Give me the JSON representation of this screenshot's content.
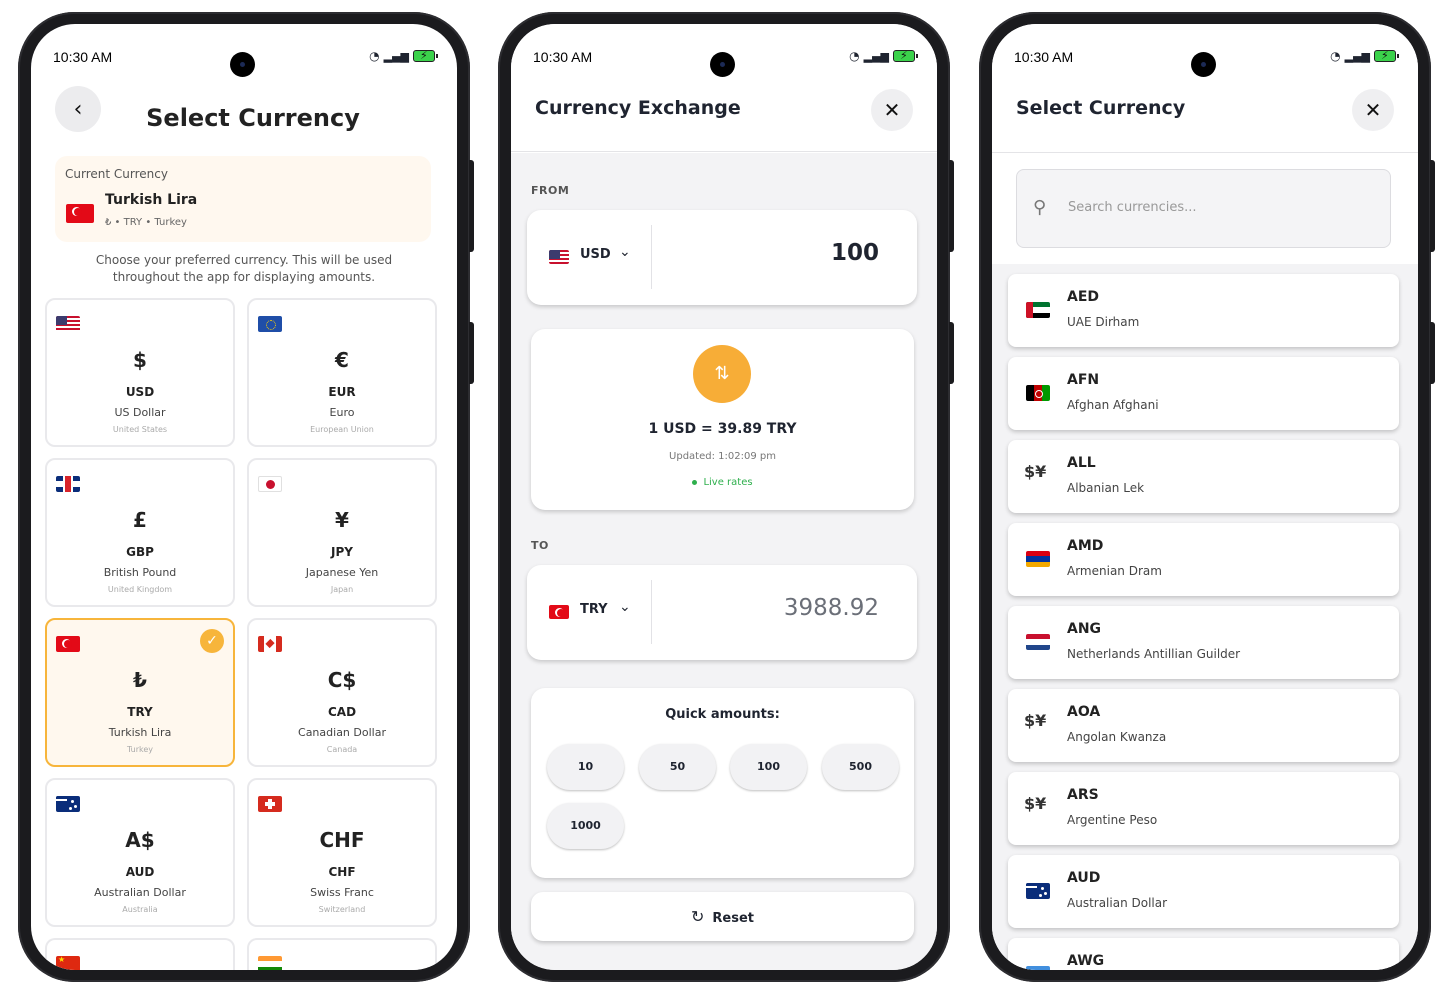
{
  "status_bar": {
    "time": "10:30 AM"
  },
  "select_currency_grid": {
    "title": "Select Currency",
    "current": {
      "label": "Current Currency",
      "name": "Turkish Lira",
      "details": "₺ • TRY • Turkey"
    },
    "description": "Choose your preferred currency. This will be used throughout the app for displaying amounts.",
    "tiles": [
      {
        "symbol": "$",
        "code": "USD",
        "name": "US Dollar",
        "country": "United States",
        "flag": "us",
        "selected": false
      },
      {
        "symbol": "€",
        "code": "EUR",
        "name": "Euro",
        "country": "European Union",
        "flag": "eu",
        "selected": false
      },
      {
        "symbol": "£",
        "code": "GBP",
        "name": "British Pound",
        "country": "United Kingdom",
        "flag": "gb",
        "selected": false
      },
      {
        "symbol": "¥",
        "code": "JPY",
        "name": "Japanese Yen",
        "country": "Japan",
        "flag": "jp",
        "selected": false
      },
      {
        "symbol": "₺",
        "code": "TRY",
        "name": "Turkish Lira",
        "country": "Turkey",
        "flag": "tr",
        "selected": true
      },
      {
        "symbol": "C$",
        "code": "CAD",
        "name": "Canadian Dollar",
        "country": "Canada",
        "flag": "ca",
        "selected": false
      },
      {
        "symbol": "A$",
        "code": "AUD",
        "name": "Australian Dollar",
        "country": "Australia",
        "flag": "au",
        "selected": false
      },
      {
        "symbol": "CHF",
        "code": "CHF",
        "name": "Swiss Franc",
        "country": "Switzerland",
        "flag": "ch",
        "selected": false
      }
    ],
    "partial_tiles": [
      {
        "flag": "cn"
      },
      {
        "flag": "in"
      }
    ]
  },
  "exchange": {
    "title": "Currency Exchange",
    "from_label": "FROM",
    "from_currency": "USD",
    "from_amount": "100",
    "rate": "1 USD = 39.89 TRY",
    "updated": "Updated: 1:02:09 pm",
    "live": "Live rates",
    "to_label": "TO",
    "to_currency": "TRY",
    "to_amount": "3988.92",
    "quick_title": "Quick amounts:",
    "quick_amounts": [
      "10",
      "50",
      "100",
      "500",
      "1000"
    ],
    "reset_label": "Reset",
    "colors": {
      "accent": "#f7ad37",
      "live": "#2eaf4c"
    }
  },
  "currency_list": {
    "title": "Select Currency",
    "search_placeholder": "Search currencies...",
    "items": [
      {
        "code": "AED",
        "name": "UAE Dirham",
        "flag": "ae"
      },
      {
        "code": "AFN",
        "name": "Afghan Afghani",
        "flag": "af"
      },
      {
        "code": "ALL",
        "name": "Albanian Lek",
        "flag": "generic"
      },
      {
        "code": "AMD",
        "name": "Armenian Dram",
        "flag": "am"
      },
      {
        "code": "ANG",
        "name": "Netherlands Antillian Guilder",
        "flag": "an"
      },
      {
        "code": "AOA",
        "name": "Angolan Kwanza",
        "flag": "generic"
      },
      {
        "code": "ARS",
        "name": "Argentine Peso",
        "flag": "generic"
      },
      {
        "code": "AUD",
        "name": "Australian Dollar",
        "flag": "au"
      },
      {
        "code": "AWG",
        "name": "",
        "flag": "aw"
      }
    ]
  }
}
